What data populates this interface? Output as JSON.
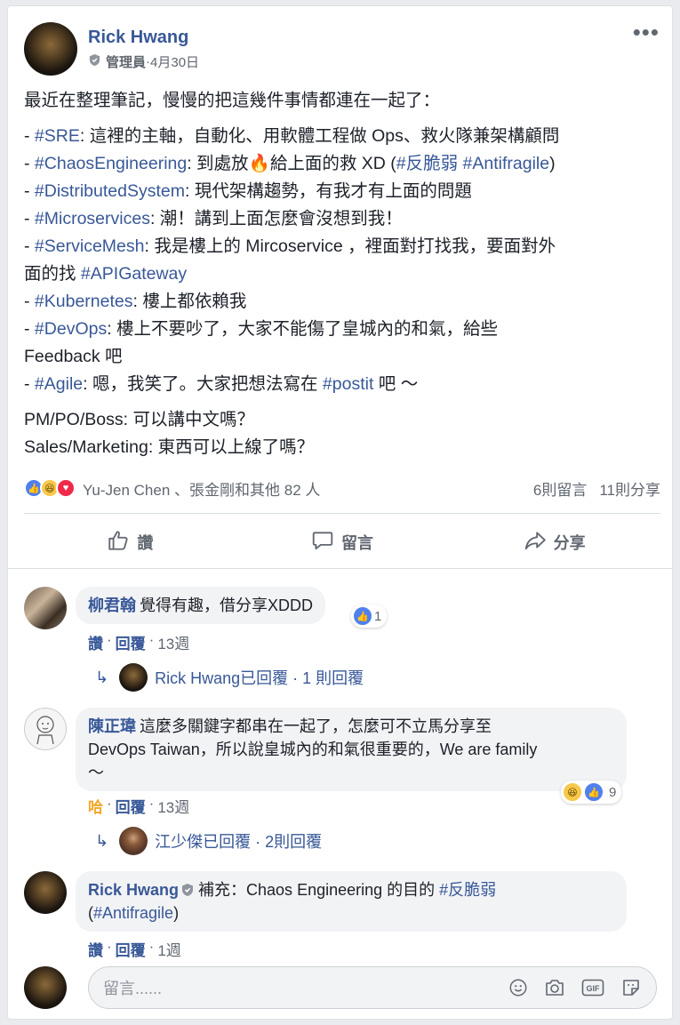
{
  "post": {
    "author": "Rick Hwang",
    "role": "管理員",
    "date_sep": " · ",
    "date": "4月30日",
    "more": "•••",
    "lines": [
      [
        {
          "t": "最近在整理筆記，慢慢的把這幾件事情都連在一起了："
        }
      ],
      [],
      [
        {
          "t": "- "
        },
        {
          "t": "#SRE",
          "tag": true
        },
        {
          "t": ": 這裡的主軸，自動化、用軟體工程做 Ops、救火隊兼架構顧問"
        }
      ],
      [
        {
          "t": "- "
        },
        {
          "t": "#ChaosEngineering",
          "tag": true
        },
        {
          "t": ": 到處放🔥給上面的救 XD ("
        },
        {
          "t": "#反脆弱",
          "tag": true
        },
        {
          "t": " "
        },
        {
          "t": "#Antifragile",
          "tag": true
        },
        {
          "t": ")"
        }
      ],
      [
        {
          "t": "- "
        },
        {
          "t": "#DistributedSystem",
          "tag": true
        },
        {
          "t": ": 現代架構趨勢，有我才有上面的問題"
        }
      ],
      [
        {
          "t": "- "
        },
        {
          "t": "#Microservices",
          "tag": true
        },
        {
          "t": ": 潮！講到上面怎麼會沒想到我！"
        }
      ],
      [
        {
          "t": "- "
        },
        {
          "t": "#ServiceMesh",
          "tag": true
        },
        {
          "t": ": 我是樓上的 Mircoservice ，裡面對打找我，要面對外"
        }
      ],
      [
        {
          "t": "面的找 "
        },
        {
          "t": "#APIGateway",
          "tag": true
        }
      ],
      [
        {
          "t": "- "
        },
        {
          "t": "#Kubernetes",
          "tag": true
        },
        {
          "t": ": 樓上都依賴我"
        }
      ],
      [
        {
          "t": "- "
        },
        {
          "t": "#DevOps",
          "tag": true
        },
        {
          "t": ": 樓上不要吵了，大家不能傷了皇城內的和氣，給些"
        }
      ],
      [
        {
          "t": "Feedback 吧"
        }
      ],
      [
        {
          "t": "- "
        },
        {
          "t": "#Agile",
          "tag": true
        },
        {
          "t": ": 嗯，我笑了。大家把想法寫在 "
        },
        {
          "t": "#postit",
          "tag": true
        },
        {
          "t": " 吧 ～"
        }
      ],
      [],
      [
        {
          "t": "PM/PO/Boss: 可以講中文嗎？"
        }
      ],
      [
        {
          "t": "Sales/Marketing: 東西可以上線了嗎？"
        }
      ]
    ]
  },
  "reactions": {
    "names": "Yu-Jen Chen 、張金剛和其他 82 人",
    "comments": "6則留言",
    "shares": "11則分享"
  },
  "actions": {
    "like": "讚",
    "comment": "留言",
    "share": "分享"
  },
  "comments": [
    {
      "name": "柳君翰",
      "text": "覺得有趣，借分享XDDD",
      "like_label": "讚",
      "reply_label": "回覆",
      "time": "13週",
      "reaction_count": "1",
      "reply_summary": "Rick Hwang已回覆 · 1 則回覆"
    },
    {
      "name": "陳正瑋",
      "text_lines": [
        "這麼多關鍵字都串在一起了，怎麼可不立馬分享至",
        "DevOps Taiwan，所以說皇城內的和氣很重要的，We are family",
        "～"
      ],
      "like_label": "哈",
      "reply_label": "回覆",
      "time": "13週",
      "reaction_count": "9",
      "reply_summary": "江少傑已回覆 · 2則回覆"
    },
    {
      "name": "Rick Hwang",
      "text_a": "補充：Chaos Engineering 的目的 ",
      "tag_a": "#反脆弱",
      "text_b": "(",
      "tag_b": "#Antifragile",
      "text_c": ")",
      "like_label": "讚",
      "reply_label": "回覆",
      "time": "1週"
    }
  ],
  "composer": {
    "placeholder": "留言......"
  },
  "colors": {
    "link": "#385898",
    "like": "#4e80f0",
    "love": "#f0284a",
    "haha": "#f7c84a"
  }
}
